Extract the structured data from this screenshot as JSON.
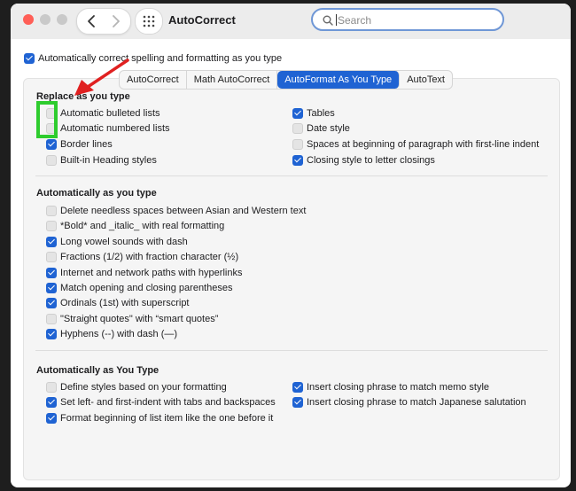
{
  "window": {
    "title": "AutoCorrect"
  },
  "search": {
    "placeholder": "Search"
  },
  "top_option": {
    "label": "Automatically correct spelling and formatting as you type",
    "checked": true
  },
  "tabs": [
    {
      "label": "AutoCorrect",
      "active": false
    },
    {
      "label": "Math AutoCorrect",
      "active": false
    },
    {
      "label": "AutoFormat As You Type",
      "active": true
    },
    {
      "label": "AutoText",
      "active": false
    }
  ],
  "replace_section": {
    "title": "Replace as you type",
    "left": [
      {
        "label": "Automatic bulleted lists",
        "checked": false
      },
      {
        "label": "Automatic numbered lists",
        "checked": false
      },
      {
        "label": "Border lines",
        "checked": true
      },
      {
        "label": "Built-in Heading styles",
        "checked": false
      }
    ],
    "right": [
      {
        "label": "Tables",
        "checked": true
      },
      {
        "label": "Date style",
        "checked": false
      },
      {
        "label": "Spaces at beginning of paragraph with first-line indent",
        "checked": false
      },
      {
        "label": "Closing style to letter closings",
        "checked": true
      }
    ]
  },
  "auto_section": {
    "title": "Automatically as you type",
    "items": [
      {
        "label": "Delete needless spaces between Asian and Western text",
        "checked": false
      },
      {
        "label": "*Bold* and _italic_ with real formatting",
        "checked": false
      },
      {
        "label": "Long vowel sounds with dash",
        "checked": true
      },
      {
        "label": "Fractions (1/2) with fraction character (½)",
        "checked": false
      },
      {
        "label": "Internet and network paths with hyperlinks",
        "checked": true
      },
      {
        "label": "Match opening and closing parentheses",
        "checked": true
      },
      {
        "label": "Ordinals (1st) with superscript",
        "checked": true
      },
      {
        "label": "\"Straight quotes\" with “smart quotes”",
        "checked": false
      },
      {
        "label": "Hyphens (--) with dash (—)",
        "checked": true
      }
    ]
  },
  "auto_type_section": {
    "title": "Automatically as You Type",
    "left": [
      {
        "label": "Define styles based on your formatting",
        "checked": false
      },
      {
        "label": "Set left- and first-indent with tabs and backspaces",
        "checked": true
      },
      {
        "label": "Format beginning of list item like the one before it",
        "checked": true
      }
    ],
    "right": [
      {
        "label": "Insert closing phrase to match memo style",
        "checked": true
      },
      {
        "label": "Insert closing phrase to match Japanese salutation",
        "checked": true
      }
    ]
  },
  "colors": {
    "accent": "#1f63d3",
    "annotation_box": "#2ecc2e",
    "annotation_arrow": "#e02020"
  }
}
